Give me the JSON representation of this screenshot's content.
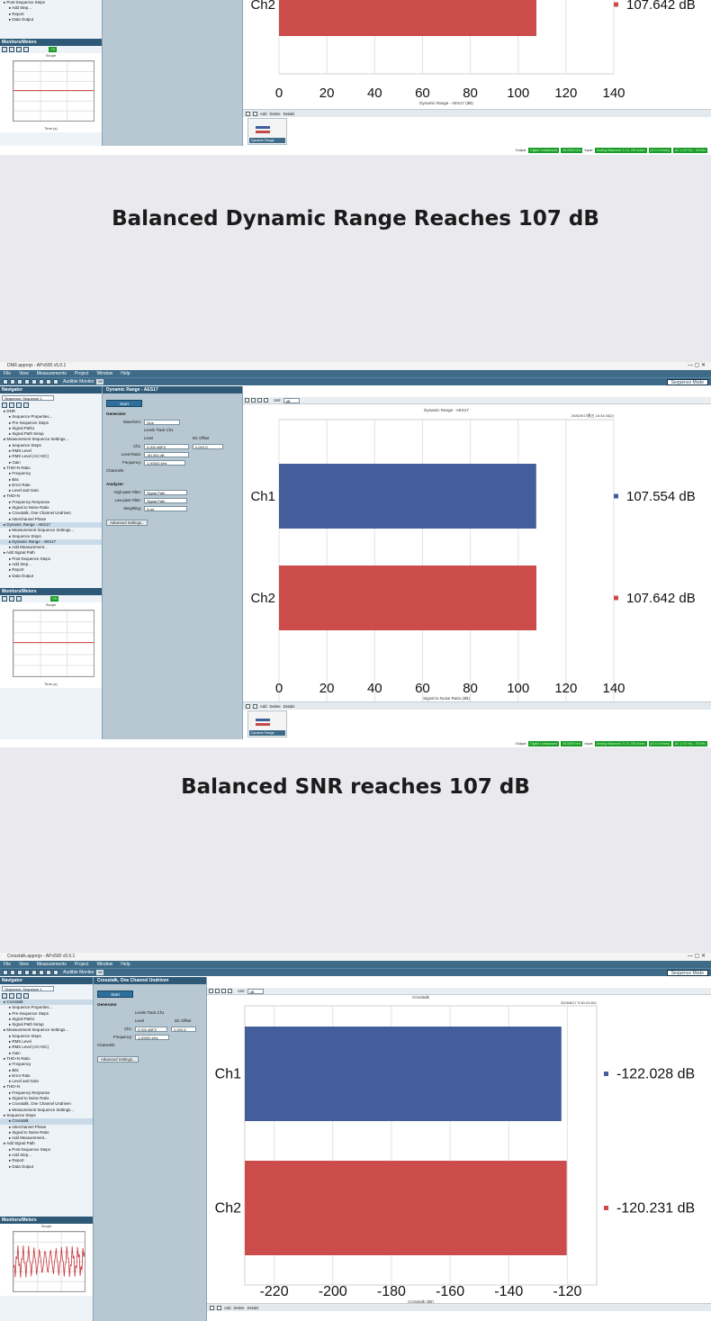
{
  "captions": {
    "first": "Balanced Dynamic Range Reaches 107 dB",
    "second": "Balanced SNR reaches 107 dB"
  },
  "app": {
    "window_title_dr": "DNR.approjx - APx500 v5.0.1",
    "window_title_ct": "Crosstalk.approjx - APx500 v5.0.1",
    "window_controls": "—   ▢   ✕",
    "menus": [
      "File",
      "View",
      "Measurements",
      "Project",
      "Window",
      "Help"
    ],
    "audible_monitor": "Audible Monitor",
    "audible_state": "Off",
    "sequence_mode": "Sequence Mode",
    "colors": {
      "titlebar": "#3d6b88",
      "ch1": "#435e9a",
      "ch2": "#cc4c4c",
      "status_green": "#1b9a2a"
    }
  },
  "navigator": {
    "title": "Navigator",
    "sequence_select": "Sequence: Sequence 1",
    "items_dr": [
      "DNR",
      "Sequence Properties...",
      "Pre-Sequence Steps",
      "Signal Path1",
      "Signal Path Setup",
      "Measurement Sequence Settings...",
      "Sequence Steps",
      "RMS Level",
      "RMS Level (AC+DC)",
      "Gain",
      "THD+N Ratio",
      "Frequency",
      "Bits",
      "Error Rate",
      "Level and Gain",
      "THD+N",
      "Frequency Response",
      "Signal to Noise Ratio",
      "Crosstalk, One Channel Undriven",
      "Interchannel Phase",
      "Dynamic Range - AES17",
      "Measurement Sequence Settings...",
      "Sequence Steps",
      "Dynamic Range - AES17",
      "Add Measurement...",
      "Add Signal Path",
      "Post-Sequence Steps",
      "Add Step...",
      "Report",
      "Data Output"
    ],
    "items_ct": [
      "Crosstalk",
      "Sequence Properties...",
      "Pre-Sequence Steps",
      "Signal Path1",
      "Signal Path Setup",
      "Measurement Sequence Settings...",
      "Sequence Steps",
      "RMS Level",
      "RMS Level (AC+DC)",
      "Gain",
      "THD+N Ratio",
      "Frequency",
      "Bits",
      "Error Rate",
      "Level and Gain",
      "THD+N",
      "Frequency Response",
      "Signal to Noise Ratio",
      "Crosstalk, One Channel Undriven",
      "Measurement Sequence Settings...",
      "Sequence Steps",
      "Crosstalk",
      "Interchannel Phase",
      "Signal to Noise Ratio",
      "Add Measurement...",
      "Add Signal Path",
      "Post-Sequence Steps",
      "Add Step...",
      "Report",
      "Data Output"
    ],
    "items_top": [
      "Post-Sequence Steps",
      "Add Step...",
      "Report",
      "Data Output"
    ]
  },
  "monitors": {
    "title": "Monitors/Meters",
    "on_badge": "ON",
    "scope_title": "Scope",
    "xlabel": "Time (s)",
    "ylabel": "Instantaneous Level (V)",
    "xticks": [
      "0",
      "1m",
      "2m"
    ]
  },
  "panel_dr": {
    "title": "Dynamic Range - AES17",
    "start": "Start",
    "generator": "Generator",
    "waveform_label": "Waveform:",
    "waveform_value": "Sine",
    "levels_track": "Levels Track Ch1",
    "level_col": "Level",
    "dc_col": "DC Offset",
    "ch1_label": "Ch1:",
    "ch1_level": "0.000 dBFS",
    "ch1_dc": "0.000 D",
    "level_ratio_label": "Level Ratio:",
    "level_ratio_value": "-60.000 dB",
    "frequency_label": "Frequency:",
    "frequency_value": "1.00000 kHz",
    "channels": "Channels",
    "analyzer": "Analyzer",
    "hp_label": "High-pass Filter:",
    "hp_value": "Signal Path",
    "lp_label": "Low-pass Filter:",
    "lp_value": "Signal Path",
    "weighting_label": "Weighting:",
    "weighting_value": "A-wt.",
    "advanced": "Advanced Settings..."
  },
  "panel_ct": {
    "title": "Crosstalk, One Channel Undriven",
    "start": "Start",
    "generator": "Generator",
    "levels_track": "Levels Track Ch1",
    "level_col": "Level",
    "dc_col": "DC Offset",
    "ch1_label": "Ch1:",
    "ch1_level": "0.000 dBFS",
    "ch1_dc": "0.000 D",
    "frequency_label": "Frequency:",
    "frequency_value": "1.00000 kHz",
    "channels": "Channels",
    "advanced": "Advanced Settings..."
  },
  "chart_toolbar": {
    "unit_label": "Unit:",
    "unit_value": "dB"
  },
  "bottom": {
    "add": "Add",
    "delete": "Delete",
    "details": "Details",
    "thumb_label": "Dynamic Range"
  },
  "status": {
    "output_label": "Output:",
    "output_value": "Digital Unbalanced",
    "output_rate": "48.0000 kHz",
    "input_label": "Input:",
    "input_value": "Analog Balanced 2 Ch, 200 kohm",
    "input_range": "[10.0 mVrms]",
    "input_coupling": "AC (<10 Hz) - 20 kHz"
  },
  "chart_data": [
    {
      "type": "bar",
      "orientation": "horizontal",
      "id": "dynamic-range-top",
      "categories": [
        "Ch2"
      ],
      "values": [
        107.642
      ],
      "value_labels": [
        "107.642 dB"
      ],
      "xlim": [
        0,
        140
      ],
      "xticks": [
        0,
        20,
        40,
        60,
        80,
        100,
        120,
        140
      ],
      "xlabel": "Dynamic Range - AES17 (dB)",
      "colors": [
        "#cc4c4c"
      ],
      "grid": true
    },
    {
      "type": "bar",
      "orientation": "horizontal",
      "id": "snr",
      "title": "Dynamic Range - AES17",
      "timestamp": "2026/8/17周五 18:34:33(2)",
      "categories": [
        "Ch1",
        "Ch2"
      ],
      "values": [
        107.554,
        107.642
      ],
      "value_labels": [
        "107.554 dB",
        "107.642 dB"
      ],
      "xlim": [
        0,
        140
      ],
      "xticks": [
        0,
        20,
        40,
        60,
        80,
        100,
        120,
        140
      ],
      "xlabel": "Signal to Noise Ratio (dB)",
      "colors": [
        "#435e9a",
        "#cc4c4c"
      ],
      "grid": true
    },
    {
      "type": "bar",
      "orientation": "horizontal",
      "id": "crosstalk",
      "title": "Crosstalk",
      "timestamp": "2026/8/17 9:30:19.601",
      "categories": [
        "Ch1",
        "Ch2"
      ],
      "values": [
        -122.028,
        -120.231
      ],
      "value_labels": [
        "-122.028 dB",
        "-120.231 dB"
      ],
      "xlim": [
        -230,
        -110
      ],
      "xticks": [
        -220,
        -200,
        -180,
        -160,
        -140,
        -120
      ],
      "xlabel": "Crosstalk (dB)",
      "colors": [
        "#435e9a",
        "#cc4c4c"
      ],
      "grid": true
    }
  ]
}
